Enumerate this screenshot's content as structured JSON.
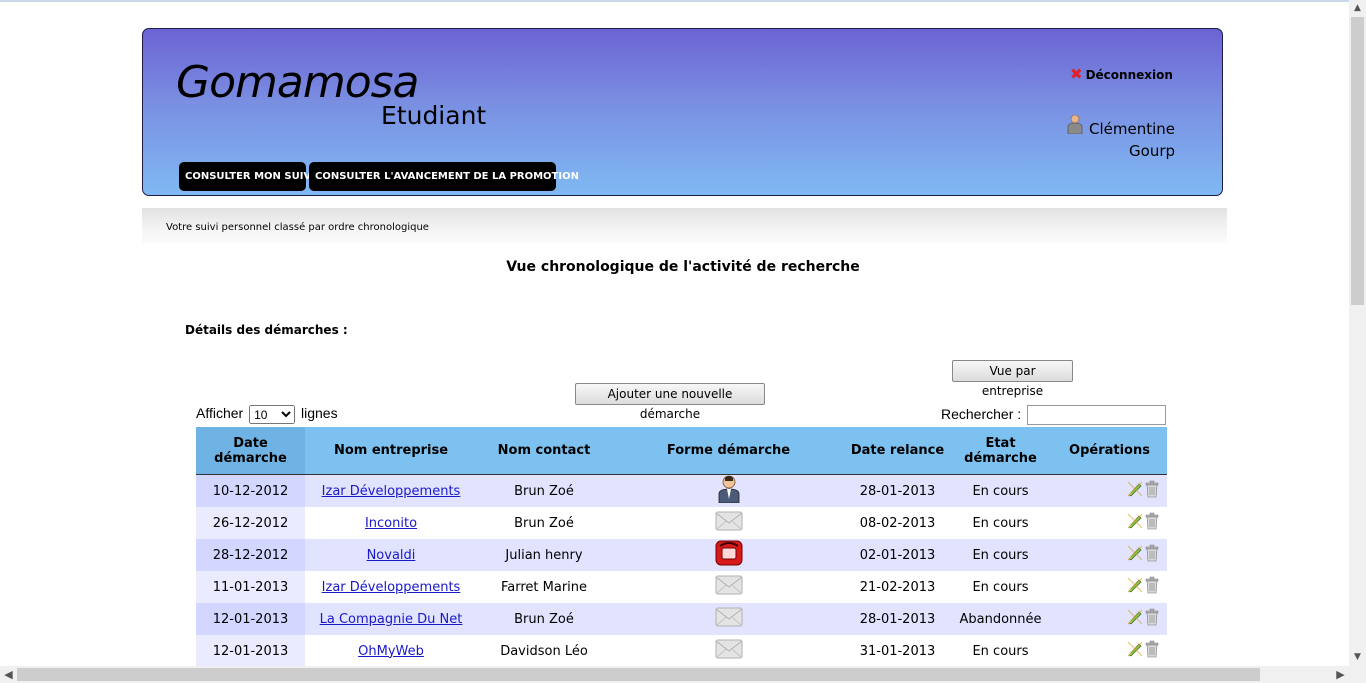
{
  "header": {
    "logo": "Gomamosa",
    "subtitle": "Etudiant",
    "nav": [
      "CONSULTER MON SUIVI",
      "CONSULTER L'AVANCEMENT DE LA PROMOTION"
    ],
    "logout": "Déconnexion",
    "user_first": "Clémentine",
    "user_last": "Gourp"
  },
  "breadcrumb": "Votre suivi personnel classé par ordre chronologique",
  "page_title": "Vue chronologique de l'activité de recherche",
  "section_title": "Détails des démarches :",
  "buttons": {
    "by_company": "Vue par entreprise",
    "add": "Ajouter une nouvelle démarche"
  },
  "length": {
    "prefix": "Afficher",
    "value": "10",
    "suffix": "lignes"
  },
  "search": {
    "label": "Rechercher :",
    "value": ""
  },
  "table": {
    "headers": [
      "Date démarche",
      "Nom entreprise",
      "Nom contact",
      "Forme démarche",
      "Date relance",
      "Etat démarche",
      "Opérations"
    ],
    "rows": [
      {
        "date": "10-12-2012",
        "company": "Izar Développements",
        "contact": "Brun Zoé",
        "form": "person-icon",
        "relance": "28-01-2013",
        "state": "En cours"
      },
      {
        "date": "26-12-2012",
        "company": "Inconito",
        "contact": "Brun Zoé",
        "form": "envelope-icon",
        "relance": "08-02-2013",
        "state": "En cours"
      },
      {
        "date": "28-12-2012",
        "company": "Novaldi",
        "contact": "Julian henry",
        "form": "phone-icon",
        "relance": "02-01-2013",
        "state": "En cours"
      },
      {
        "date": "11-01-2013",
        "company": "Izar Développements",
        "contact": "Farret Marine",
        "form": "envelope-icon",
        "relance": "21-02-2013",
        "state": "En cours"
      },
      {
        "date": "12-01-2013",
        "company": "La Compagnie Du Net",
        "contact": "Brun Zoé",
        "form": "envelope-icon",
        "relance": "28-01-2013",
        "state": "Abandonnée"
      },
      {
        "date": "12-01-2013",
        "company": "OhMyWeb",
        "contact": "Davidson Léo",
        "form": "envelope-icon",
        "relance": "31-01-2013",
        "state": "En cours"
      }
    ]
  },
  "colors": {
    "header_top": "#6b63d3",
    "header_bottom": "#7fb9f3",
    "table_head": "#7cc1ef",
    "row_odd": "#e2e4ff",
    "link": "#1919c8"
  }
}
